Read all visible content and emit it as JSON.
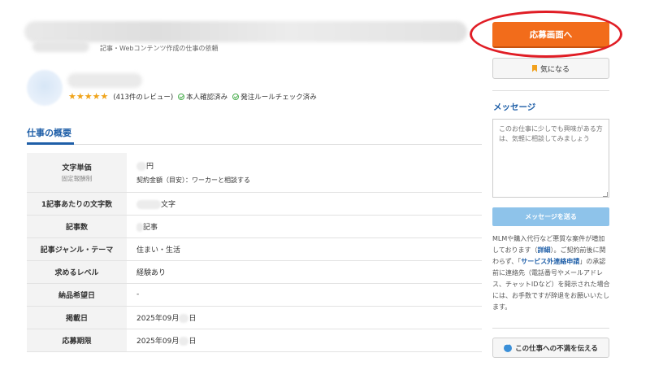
{
  "header": {
    "subtitle": "記事・Webコンテンツ作成の仕事の依頼"
  },
  "client": {
    "stars": "★★★★★",
    "reviews": "(413件のレビュー)",
    "identity_check": "本人確認済み",
    "rule_check": "発注ルールチェック済み"
  },
  "tab": {
    "label": "仕事の概要"
  },
  "summary": {
    "rows": [
      {
        "label": "文字単価",
        "sublabel": "固定報酬制",
        "value": "円",
        "value_sub": "契約金額（目安）：ワーカーと相談する"
      },
      {
        "label": "1記事あたりの文字数",
        "value": "文字"
      },
      {
        "label": "記事数",
        "value": "記事"
      },
      {
        "label": "記事ジャンル・テーマ",
        "value": "住まい・生活"
      },
      {
        "label": "求めるレベル",
        "value": "経験あり"
      },
      {
        "label": "納品希望日",
        "value": "-"
      },
      {
        "label": "掲載日",
        "value": "2025年09月",
        "value_suffix": "日"
      },
      {
        "label": "応募期限",
        "value": "2025年09月",
        "value_suffix": "日"
      }
    ]
  },
  "sidebar": {
    "apply_label": "応募画面へ",
    "favorite_label": "気になる",
    "message_heading": "メッセージ",
    "message_placeholder": "このお仕事に少しでも興味がある方は、気軽に相談してみましょう",
    "send_label": "メッセージを送る",
    "notice_part1": "MLMや購入代行など悪質な案件が増加しております（",
    "notice_link1": "詳細",
    "notice_part2": "）。ご契約前後に関わらず、「",
    "notice_link2": "サービス外連絡申請",
    "notice_part3": "」の承認前に連絡先（電話番号やメールアドレス、チャットIDなど）を開示された場合には、お手数ですが辞退をお願いいたします。",
    "complaint_label": "この仕事への不満を伝える"
  },
  "colors": {
    "accent_orange": "#f26c1b",
    "link_blue": "#1f5fa8",
    "annotation_red": "#e01d25"
  }
}
